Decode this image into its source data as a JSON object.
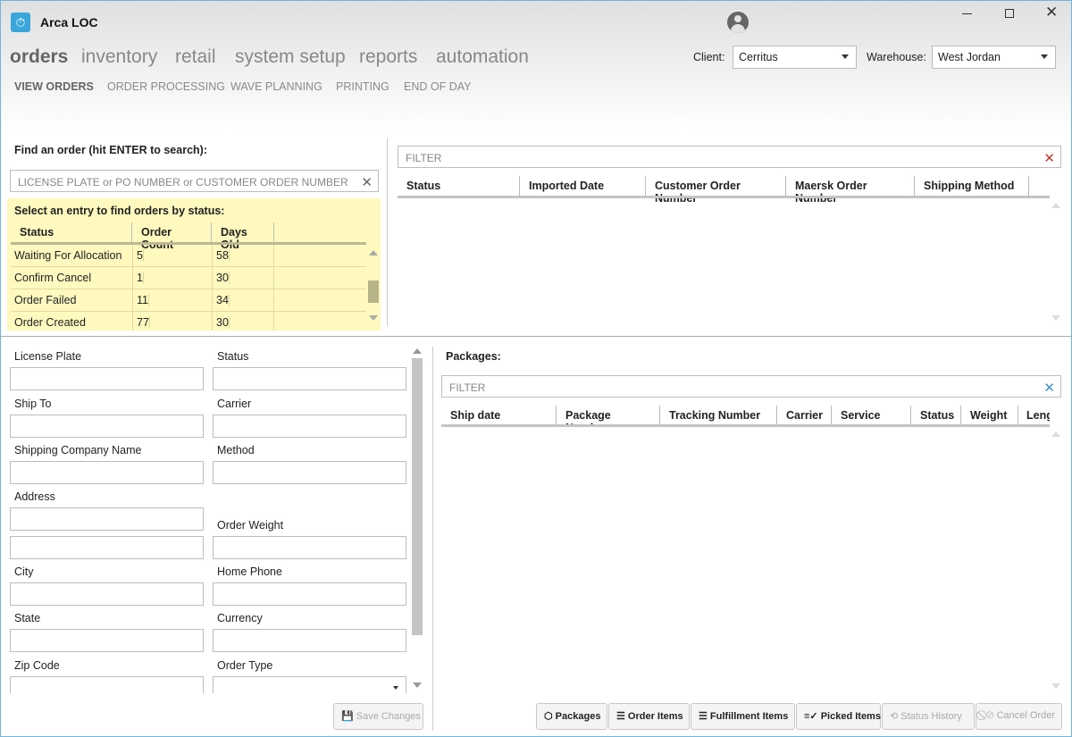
{
  "app": {
    "title": "Arca LOC"
  },
  "nav": {
    "main": [
      "orders",
      "inventory",
      "retail",
      "system setup",
      "reports",
      "automation"
    ],
    "active": "orders",
    "sub": [
      "VIEW ORDERS",
      "ORDER PROCESSING",
      "WAVE PLANNING",
      "PRINTING",
      "END OF DAY"
    ]
  },
  "client": {
    "label": "Client:",
    "value": "Cerritus"
  },
  "warehouse": {
    "label": "Warehouse:",
    "value": "West Jordan"
  },
  "search": {
    "label": "Find an order (hit ENTER to search):",
    "placeholder": "LICENSE PLATE or PO NUMBER or CUSTOMER ORDER NUMBER"
  },
  "status_table": {
    "title": "Select an entry to find orders by status:",
    "columns": [
      "Status",
      "Order Count",
      "Days Old"
    ],
    "rows": [
      [
        "Waiting For Allocation",
        "5",
        "58"
      ],
      [
        "Confirm Cancel",
        "1",
        "30"
      ],
      [
        "Order Failed",
        "11",
        "34"
      ],
      [
        "Order Created",
        "77",
        "30"
      ]
    ]
  },
  "orders_grid": {
    "filter_placeholder": "FILTER",
    "columns": [
      "Status",
      "Imported Date",
      "Customer Order Number",
      "Maersk Order Number",
      "Shipping Method"
    ]
  },
  "form": {
    "fields": {
      "license_plate": "License Plate",
      "status": "Status",
      "ship_to": "Ship To",
      "carrier": "Carrier",
      "shipping_company": "Shipping Company Name",
      "method": "Method",
      "address": "Address",
      "order_weight": "Order Weight",
      "city": "City",
      "home_phone": "Home Phone",
      "state": "State",
      "currency": "Currency",
      "zip": "Zip Code",
      "order_type": "Order Type"
    },
    "save": "Save Changes"
  },
  "packages": {
    "label": "Packages:",
    "filter_placeholder": "FILTER",
    "columns": [
      "Ship date",
      "Package Number",
      "Tracking Number",
      "Carrier",
      "Service",
      "Status",
      "Weight",
      "Leng"
    ]
  },
  "actions": {
    "packages": "Packages",
    "order_items": "Order Items",
    "fulfillment_items": "Fulfillment Items",
    "picked_items": "Picked Items",
    "status_history": "Status History",
    "cancel_order": "Cancel Order"
  },
  "colors": {
    "accent": "#3aa6db",
    "highlight": "#fff9c0"
  }
}
